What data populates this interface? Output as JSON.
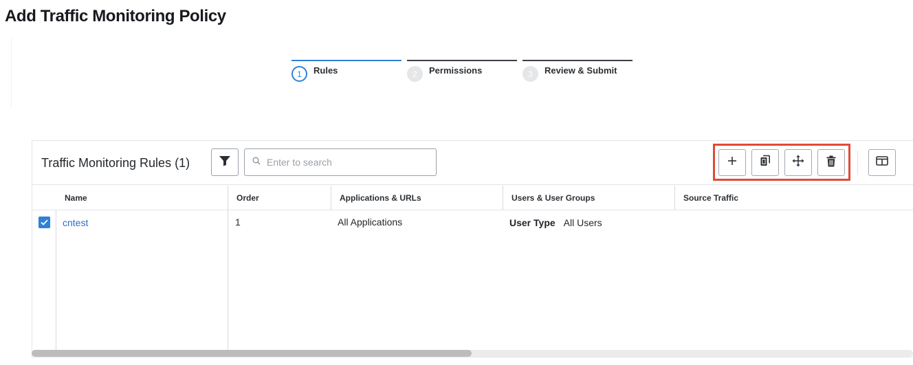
{
  "page": {
    "title": "Add Traffic Monitoring Policy"
  },
  "stepper": {
    "steps": [
      {
        "number": "1",
        "label": "Rules",
        "active": true
      },
      {
        "number": "2",
        "label": "Permissions",
        "active": false
      },
      {
        "number": "3",
        "label": "Review & Submit",
        "active": false
      }
    ]
  },
  "table": {
    "title": "Traffic Monitoring Rules (1)",
    "search_placeholder": "Enter to search",
    "icons": {
      "filter": "filter-icon",
      "search": "search-icon",
      "add": "plus-icon",
      "clone": "clone-icon",
      "move": "move-icon",
      "delete": "trash-icon",
      "columns": "columns-icon"
    },
    "columns": [
      "Name",
      "Order",
      "Applications & URLs",
      "Users & User Groups",
      "Source Traffic"
    ],
    "rows": [
      {
        "selected": true,
        "name": "cntest",
        "order": "1",
        "applications": "All Applications",
        "user_type_label": "User Type",
        "user_type_value": "All Users"
      }
    ]
  },
  "colors": {
    "accent": "#2f80d8",
    "highlight": "#e04b36",
    "link": "#2a6fc9"
  }
}
